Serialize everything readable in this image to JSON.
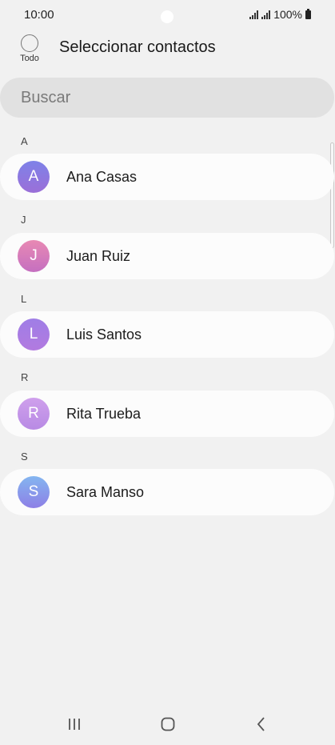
{
  "status_bar": {
    "time": "10:00",
    "battery": "100%"
  },
  "header": {
    "select_all_label": "Todo",
    "title": "Seleccionar contactos"
  },
  "search": {
    "placeholder": "Buscar"
  },
  "contacts": [
    {
      "letter": "A",
      "name": "Ana Casas",
      "initial": "A",
      "avatar_color_top": "#7e82e8",
      "avatar_color_bottom": "#9b6fd8"
    },
    {
      "letter": "J",
      "name": "Juan Ruiz",
      "initial": "J",
      "avatar_color_top": "#e889b3",
      "avatar_color_bottom": "#c56fc0"
    },
    {
      "letter": "L",
      "name": "Luis Santos",
      "initial": "L",
      "avatar_color_top": "#9f7ee6",
      "avatar_color_bottom": "#b27ae0"
    },
    {
      "letter": "R",
      "name": "Rita Trueba",
      "initial": "R",
      "avatar_color_top": "#cfa0ec",
      "avatar_color_bottom": "#b88ae4"
    },
    {
      "letter": "S",
      "name": "Sara Manso",
      "initial": "S",
      "avatar_color_top": "#84b6f0",
      "avatar_color_bottom": "#8d7fe6"
    }
  ],
  "nav_bar": {
    "recents_icon": "recents-icon",
    "home_icon": "home-icon",
    "back_icon": "back-icon"
  }
}
